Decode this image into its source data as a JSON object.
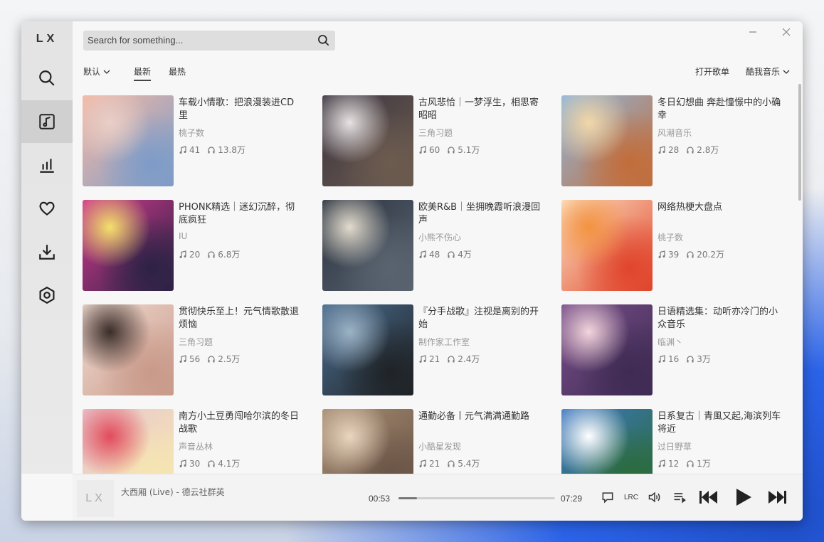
{
  "app": {
    "logo": "LX"
  },
  "search": {
    "placeholder": "Search for something..."
  },
  "tabs": {
    "sort": "默认",
    "latest": "最新",
    "hot": "最热"
  },
  "actions": {
    "open_list": "打开歌单",
    "source": "酷我音乐"
  },
  "playlists": [
    {
      "title": "车载小情歌：把浪漫装进CD里",
      "author": "桃子数",
      "songs": "41",
      "plays": "13.8万",
      "palette": [
        "#f6b9a4",
        "#e9cfc7",
        "#7d9cc8"
      ]
    },
    {
      "title": "古风悲恰｜一梦浮生，相思寄昭昭",
      "author": "三角习题",
      "songs": "60",
      "plays": "5.1万",
      "palette": [
        "#3b3540",
        "#e7e2e3",
        "#6c5b4f"
      ]
    },
    {
      "title": "冬日幻想曲 奔赴憧憬中的小确幸",
      "author": "风潮音乐",
      "songs": "28",
      "plays": "2.8万",
      "palette": [
        "#90b8de",
        "#f2d7a8",
        "#c26d3a"
      ]
    },
    {
      "title": "PHONK精选｜迷幻沉醉，彻底疯狂",
      "author": "IU",
      "songs": "20",
      "plays": "6.8万",
      "palette": [
        "#d43a8f",
        "#f4e06b",
        "#2c2245"
      ]
    },
    {
      "title": "欧美R&B｜坐拥晚霞听浪漫回声",
      "author": "小熊不伤心",
      "songs": "48",
      "plays": "4万",
      "palette": [
        "#2b3340",
        "#e3dccd",
        "#5a6470"
      ]
    },
    {
      "title": "网络热梗大盘点",
      "author": "桃子数",
      "songs": "39",
      "plays": "20.2万",
      "palette": [
        "#fde3c2",
        "#f39340",
        "#e0452c"
      ]
    },
    {
      "title": "贯彻快乐至上！元气情歌散退烦恼",
      "author": "三角习题",
      "songs": "56",
      "plays": "2.5万",
      "palette": [
        "#f1dcd2",
        "#3a2c28",
        "#c99a8a"
      ]
    },
    {
      "title": "『分手战歌』注视是离别的开始",
      "author": "制作家工作室",
      "songs": "21",
      "plays": "2.4万",
      "palette": [
        "#4b6d8e",
        "#9cb3c6",
        "#1f2327"
      ]
    },
    {
      "title": "日语精选集：动听亦冷门的小众音乐",
      "author": "临渊丶",
      "songs": "16",
      "plays": "3万",
      "palette": [
        "#7a4f8a",
        "#f2d5dc",
        "#3e2b53"
      ]
    },
    {
      "title": "南方小土豆勇闯哈尔滨的冬日战歌",
      "author": "声音丛林",
      "songs": "30",
      "plays": "4.1万",
      "palette": [
        "#e8c6cf",
        "#e24b5b",
        "#f6e6b1"
      ]
    },
    {
      "title": "通勤必备丨元气满满通勤路",
      "author": "小酷星发现",
      "songs": "21",
      "plays": "5.4万",
      "palette": [
        "#a78e74",
        "#e9d6bf",
        "#6a5446"
      ]
    },
    {
      "title": "日系复古｜青風又起,海滨列车将近",
      "author": "过日野草",
      "songs": "12",
      "plays": "1万",
      "palette": [
        "#3d78c4",
        "#ffffff",
        "#2b6b3a"
      ]
    }
  ],
  "player": {
    "cover_text": "LX",
    "title": "大西厢 (Live) - 德云社群英",
    "current_time": "00:53",
    "total_time": "07:29",
    "progress": 0.118,
    "lrc_label": "LRC"
  }
}
